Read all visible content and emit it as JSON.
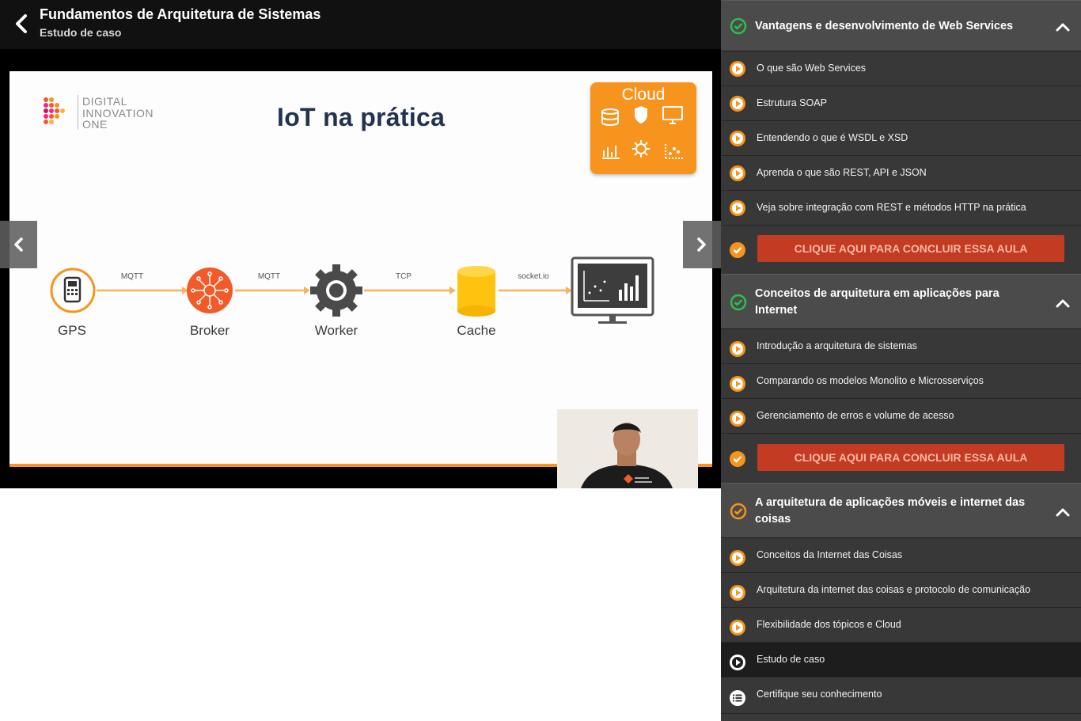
{
  "header": {
    "title": "Fundamentos de Arquitetura de Sistemas",
    "subtitle": "Estudo de caso"
  },
  "slide": {
    "logo_lines": [
      "DIGITAL",
      "INNOVATION",
      "ONE"
    ],
    "title": "IoT na prática",
    "cloud_label": "Cloud",
    "nodes": [
      "GPS",
      "Broker",
      "Worker",
      "Cache"
    ],
    "edges": [
      "MQTT",
      "MQTT",
      "TCP",
      "socket.io"
    ],
    "accent_color": "#f7941d"
  },
  "sidebar": {
    "sections": [
      {
        "title": "Vantagens e desenvolvimento de Web Services",
        "status": "completed",
        "lessons": [
          "O que são Web Services",
          "Estrutura SOAP",
          "Entendendo o que é WSDL e XSD",
          "Aprenda o que são REST, API e JSON",
          "Veja sobre integração com REST e métodos HTTP na prática"
        ],
        "conclude_label": "CLIQUE AQUI PARA CONCLUIR ESSA AULA"
      },
      {
        "title": "Conceitos de arquitetura em aplicações para Internet",
        "status": "completed",
        "lessons": [
          "Introdução a arquitetura de sistemas",
          "Comparando os modelos Monolito e Microsserviços",
          "Gerenciamento de erros e volume de acesso"
        ],
        "conclude_label": "CLIQUE AQUI PARA CONCLUIR ESSA AULA"
      },
      {
        "title": "A arquitetura de aplicações móveis e internet das coisas",
        "status": "in-progress",
        "lessons": [
          "Conceitos da Internet das Coisas",
          "Arquitetura da internet das coisas e protocolo de comunicação",
          "Flexibilidade dos tópicos e Cloud",
          "Estudo de caso",
          "Certifique seu conhecimento"
        ]
      }
    ],
    "colors": {
      "complete": "#2ebd4f",
      "accent": "#f7941d",
      "button": "#c23b22"
    }
  }
}
